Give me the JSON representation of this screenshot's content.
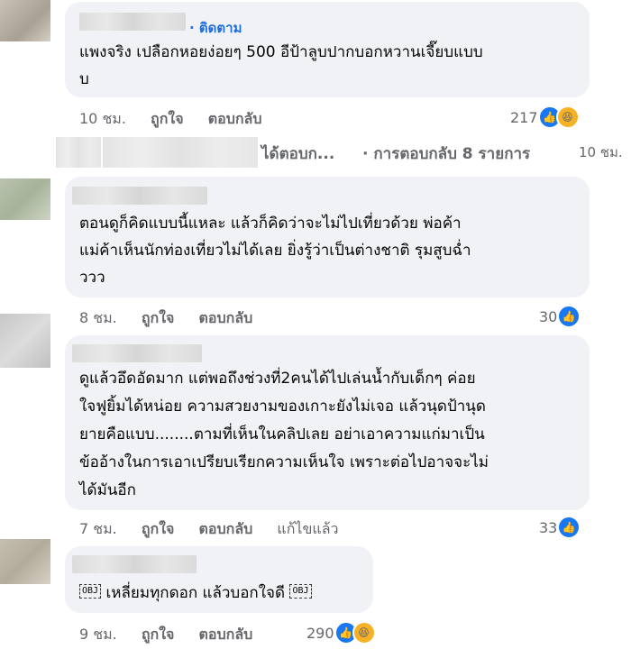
{
  "comments": [
    {
      "follow_label": "· ติดตาม",
      "lines": [
        "แพงจริง เปลือกหอยง่อยๆ 500 อีป้าลูบปากบอกหวานเจี๊ยบแบบ",
        "บ"
      ],
      "time": "10 ชม.",
      "like_label": "ถูกใจ",
      "reply_label": "ตอบกลับ",
      "reaction_count": "217"
    },
    {
      "lines": [
        "ตอนดูก็คิดแบบนี้แหละ แล้วก็คิดว่าจะไม่ไปเที่ยวด้วย พ่อค้า",
        "แม่ค้าเห็นนักท่องเที่ยวไม่ได้เลย ยิ่งรู้ว่าเป็นต่างชาติ รุมสูบฉ่ำ",
        "ววว"
      ],
      "time": "8 ชม.",
      "like_label": "ถูกใจ",
      "reply_label": "ตอบกลับ",
      "reaction_count": "30"
    },
    {
      "lines": [
        "ดูแล้วอึดอัดมาก แต่พอถึงช่วงที่2คนได้ไปเล่นน้ำกับเด็กๆ ค่อย",
        "ใจฟูยิ้มได้หน่อย ความสวยงามของเกาะยังไม่เจอ แล้วนุดป้านุด",
        "ยายคือแบบ........ตามที่เห็นในคลิปเลย อย่าเอาความแก่มาเป็น",
        "ข้ออ้างในการเอาเปรียบเรียกความเห็นใจ เพราะต่อไปอาจจะไม่",
        "ได้มันอีก"
      ],
      "time": "7 ชม.",
      "like_label": "ถูกใจ",
      "reply_label": "ตอบกลับ",
      "edited_label": "แก้ไขแล้ว",
      "reaction_count": "33"
    },
    {
      "obj_glyph": "OBJ",
      "text": " เหลี่ยมทุกดอก แล้วบอกใจดี ",
      "time": "9 ชม.",
      "like_label": "ถูกใจ",
      "reply_label": "ตอบกลับ",
      "reaction_count": "290"
    }
  ],
  "replies_summary": {
    "replied_text": "ได้ตอบก...",
    "count_text": "· การตอบกลับ 8 รายการ",
    "time": "10 ชม."
  },
  "colors": {
    "bubble": "#f0f2f5",
    "follow": "#216fdb",
    "meta": "#65676b",
    "like": "#1877f2",
    "haha": "#f7b125"
  },
  "icons": [
    "like-icon",
    "haha-icon"
  ]
}
